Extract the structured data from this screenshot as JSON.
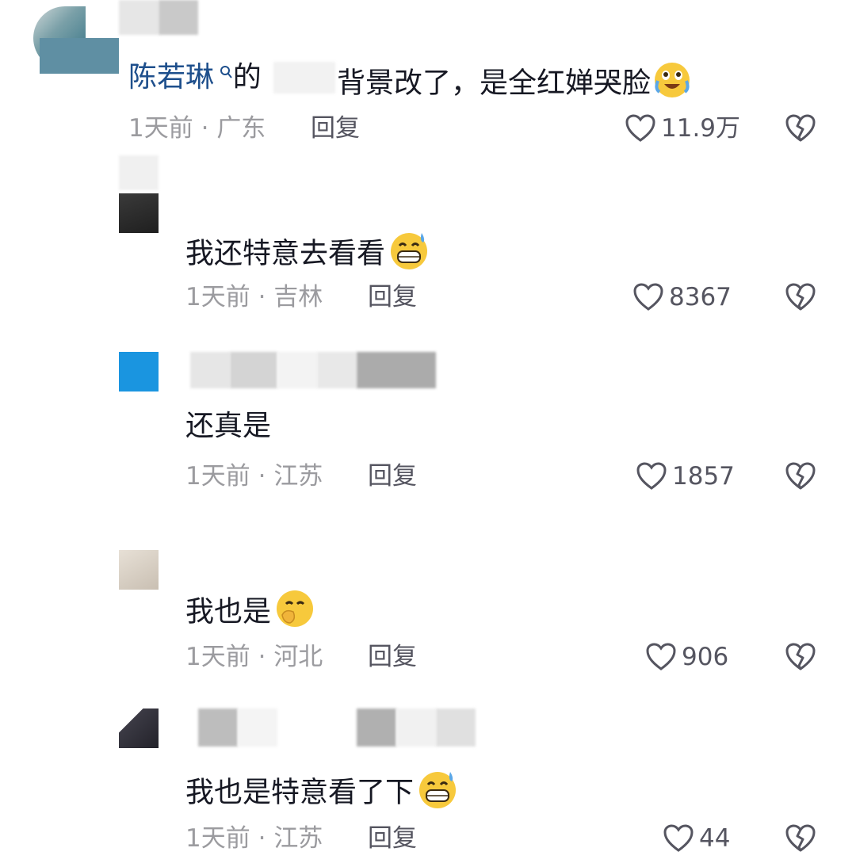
{
  "comments": [
    {
      "mention": "陈若琳",
      "mention_icon": "search-icon",
      "mention_suffix": "的",
      "text": "背景改了，是全红婵哭脸",
      "emoji": "crying-laughing-emoji",
      "time": "1天前",
      "location": "广东",
      "reply": "回复",
      "likes": "11.9万"
    },
    {
      "text": "我还特意去看看",
      "emoji": "grinning-sweat-emoji",
      "time": "1天前",
      "location": "吉林",
      "reply": "回复",
      "likes": "8367"
    },
    {
      "text": "还真是",
      "time": "1天前",
      "location": "江苏",
      "reply": "回复",
      "likes": "1857"
    },
    {
      "text": "我也是",
      "emoji": "covering-mouth-emoji",
      "time": "1天前",
      "location": "河北",
      "reply": "回复",
      "likes": "906"
    },
    {
      "text": "我也是特意看了下",
      "emoji": "grinning-sweat-emoji",
      "time": "1天前",
      "location": "江苏",
      "reply": "回复",
      "likes": "44"
    }
  ],
  "separator": "·",
  "colors": {
    "mention": "#1e4f8c",
    "meta": "#9b9b9f",
    "text": "#161823"
  }
}
